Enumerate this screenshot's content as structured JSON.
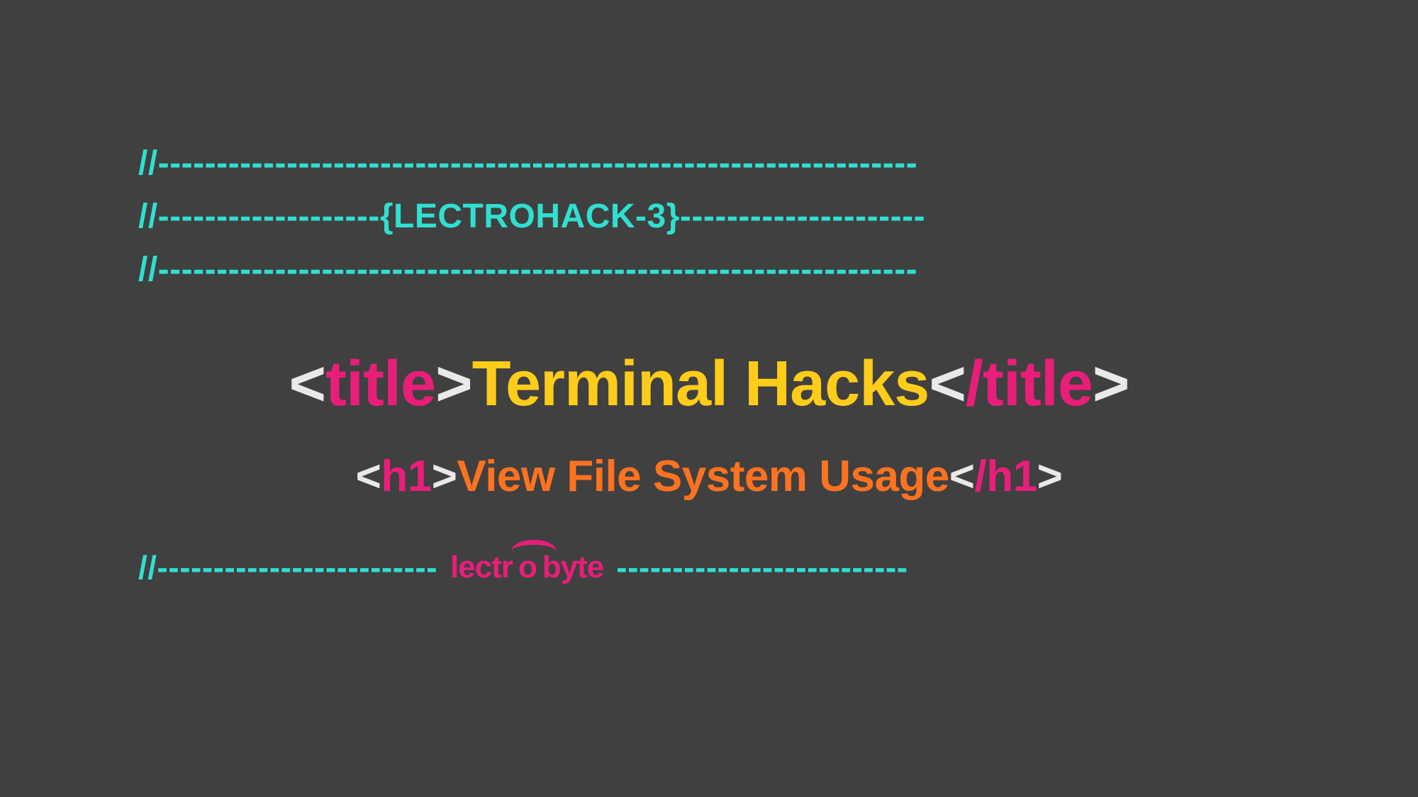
{
  "comment": {
    "l1": "//-----------------------------------------------------------------",
    "l2_pre": "//-------------------",
    "l2_badge": "{LECTROHACK-3}",
    "l2_post": "---------------------",
    "l3": "//-----------------------------------------------------------------"
  },
  "title": {
    "angle_open": "<",
    "tag_open": "title",
    "gt1": ">",
    "text": "Terminal Hacks",
    "angle_close_open": "<",
    "slash": "/",
    "tag_close": "title",
    "gt2": ">"
  },
  "subtitle": {
    "angle_open": "<",
    "tag_open": "h1",
    "gt1": ">",
    "text": "View File System Usage",
    "angle_close_open": "<",
    "slash": "/",
    "tag_close": "h1",
    "gt2": ">"
  },
  "footer": {
    "lead": "//-------------------------",
    "brand_pre": "lectr",
    "brand_swoosh": "o",
    "brand_post": "byte",
    "tail": " --------------------------"
  }
}
